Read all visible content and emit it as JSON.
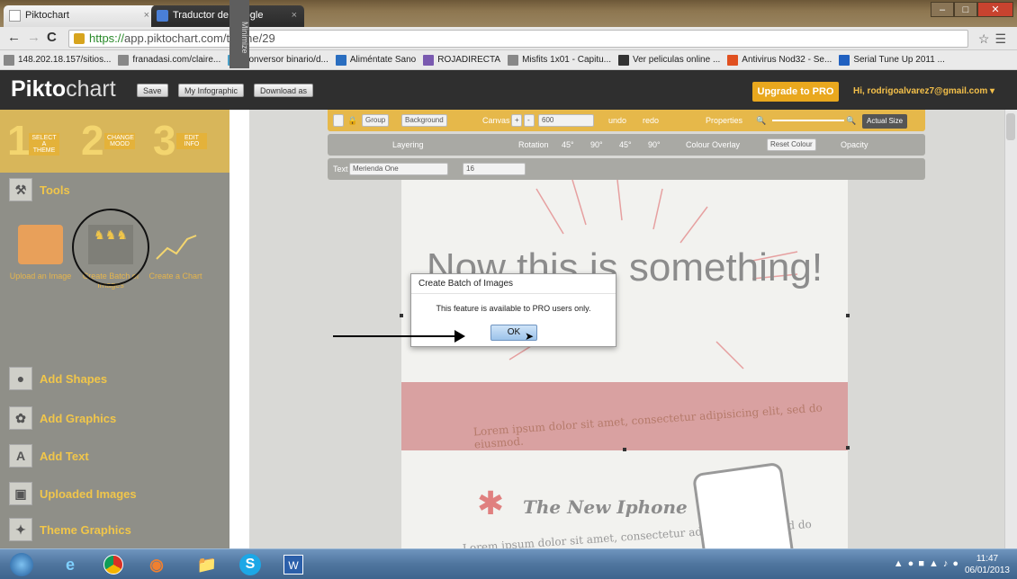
{
  "browser": {
    "tabs": [
      {
        "label": "Piktochart",
        "close": "×"
      },
      {
        "label": "Traductor de Google",
        "close": "×"
      }
    ],
    "url_scheme": "https://",
    "url_rest": "app.piktochart.com/theme/29",
    "bookmarks": [
      "148.202.18.157/sitios...",
      "franadasi.com/claire...",
      "Conversor binario/d...",
      "Aliméntate Sano",
      "ROJADIRECTA",
      "Misfits 1x01 - Capitu...",
      "Ver peliculas online ...",
      "Antivirus Nod32 - Se...",
      "Serial Tune Up 2011 ..."
    ]
  },
  "app": {
    "logo_bold": "Pikto",
    "logo_thin": "chart",
    "save": "Save",
    "my_infographic": "My Infographic",
    "download": "Download as",
    "upgrade": "Upgrade to PRO",
    "user": "Hi, rodrigoalvarez7@gmail.com ▾"
  },
  "steps": [
    {
      "num": "1",
      "label": "SELECT A THEME"
    },
    {
      "num": "2",
      "label": "CHANGE MOOD"
    },
    {
      "num": "3",
      "label": "EDIT INFO"
    }
  ],
  "minimize": "Minimize",
  "tools": {
    "heading": "Tools",
    "items": [
      "Upload an Image",
      "Create Batch of Images",
      "Create a Chart"
    ]
  },
  "sections": [
    "Add Shapes",
    "Add Graphics",
    "Add Text",
    "Uploaded Images",
    "Theme Graphics"
  ],
  "controls": {
    "group": "Group",
    "background": "Background",
    "canvas": "Canvas",
    "canvas_value": "600",
    "undo": "undo",
    "redo": "redo",
    "properties": "Properties",
    "actual_size": "Actual Size",
    "layering": "Layering",
    "rotation": "Rotation",
    "rot_vals": [
      "45°",
      "90°",
      "45°",
      "90°"
    ],
    "colour_overlay": "Colour Overlay",
    "reset_colour": "Reset Colour",
    "opacity": "Opacity",
    "text_label": "Text",
    "font": "Merienda One",
    "size": "16"
  },
  "poster": {
    "headline": "Now this is something!",
    "banner": "Lorem ipsum dolor sit amet, consectetur adipisicing elit, sed do eiusmod.",
    "iphone_title": "The New Iphone",
    "iphone_text": "Lorem ipsum dolor sit amet, consectetur adipisicing elit, sed do eiusmod tempor"
  },
  "dialog": {
    "title": "Create Batch of Images",
    "message": "This feature is available to PRO users only.",
    "ok": "OK"
  },
  "taskbar": {
    "time": "11:47",
    "date": "06/01/2013"
  },
  "colors": {
    "accent": "#e6b84a",
    "brand_dark": "#2f2f2f",
    "banner": "#d9a1a1"
  }
}
